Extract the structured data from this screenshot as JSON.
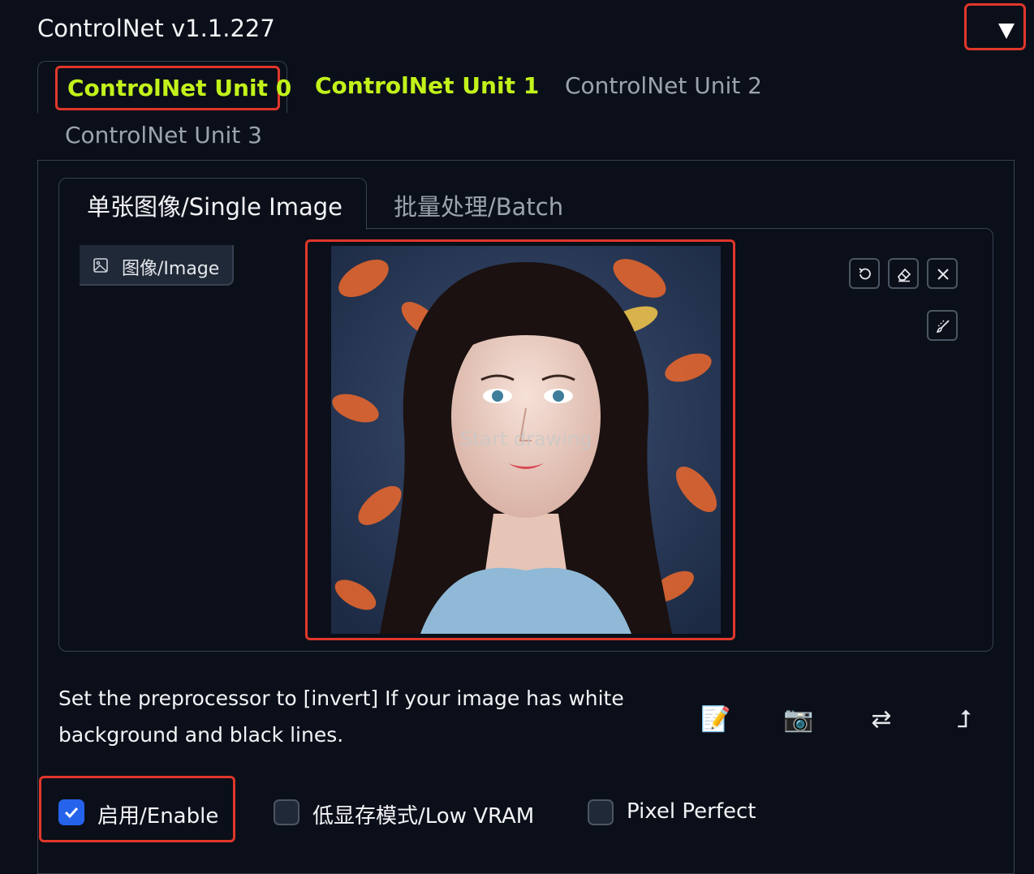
{
  "header": {
    "title": "ControlNet v1.1.227",
    "collapse_icon": "triangle-down-icon"
  },
  "unit_tabs": [
    {
      "label": "ControlNet Unit 0",
      "active": true
    },
    {
      "label": "ControlNet Unit 1",
      "active": false
    },
    {
      "label": "ControlNet Unit 2",
      "active": false
    },
    {
      "label": "ControlNet Unit 3",
      "active": false
    }
  ],
  "input_tabs": [
    {
      "label": "单张图像/Single Image",
      "active": true
    },
    {
      "label": "批量处理/Batch",
      "active": false
    }
  ],
  "image_panel": {
    "label": "图像/Image",
    "overlay_text": "Start drawing",
    "tools": [
      "undo-icon",
      "eraser-icon",
      "close-icon",
      "brush-icon"
    ]
  },
  "hint": {
    "text": "Set the preprocessor to [invert] If your image has white background and black lines."
  },
  "actions": [
    {
      "name": "edit-icon",
      "glyph": "📝"
    },
    {
      "name": "camera-icon",
      "glyph": "📷"
    },
    {
      "name": "swap-icon",
      "glyph": "⇄"
    },
    {
      "name": "send-dimensions-icon",
      "glyph": "⮥"
    }
  ],
  "options": [
    {
      "label": "启用/Enable",
      "checked": true
    },
    {
      "label": "低显存模式/Low VRAM",
      "checked": false
    },
    {
      "label": "Pixel Perfect",
      "checked": false
    }
  ],
  "colors": {
    "accent_green": "#c2f21a",
    "highlight_red": "#e0372b",
    "checkbox_blue": "#2563eb",
    "background": "#0b0f19"
  }
}
